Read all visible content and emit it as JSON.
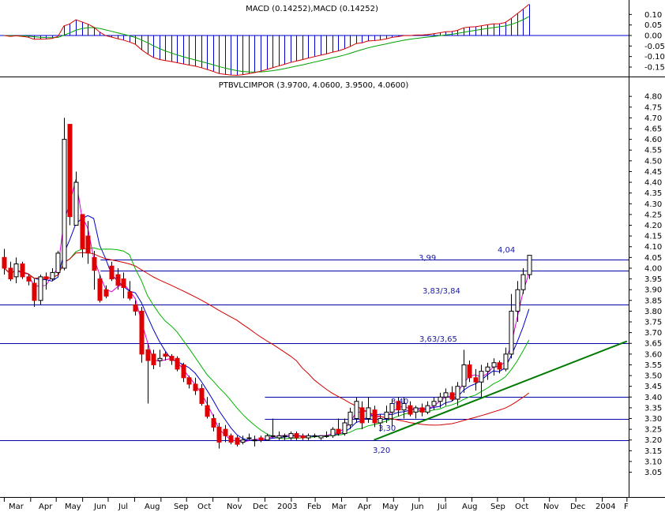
{
  "macd_panel": {
    "title": "MACD (0.14252),MACD (0.14252)",
    "ticks": [
      "0.10",
      "0.05",
      "0.00",
      "-0.05",
      "-0.10",
      "-0.15"
    ],
    "tick_values": [
      0.1,
      0.05,
      0.0,
      -0.05,
      -0.1,
      -0.15
    ],
    "ylim": [
      -0.18,
      0.15
    ]
  },
  "price_panel": {
    "title": "PTBVLCIMPOR (3.9700, 4.0600, 3.9500, 4.0600)",
    "ticks": [
      "4.80",
      "4.75",
      "4.70",
      "4.65",
      "4.60",
      "4.55",
      "4.50",
      "4.45",
      "4.40",
      "4.35",
      "4.30",
      "4.25",
      "4.20",
      "4.15",
      "4.10",
      "4.05",
      "4.00",
      "3.95",
      "3.90",
      "3.85",
      "3.80",
      "3.75",
      "3.70",
      "3.65",
      "3.60",
      "3.55",
      "3.50",
      "3.45",
      "3.40",
      "3.35",
      "3.30",
      "3.25",
      "3.20",
      "3.15",
      "3.10",
      "3.05"
    ],
    "ylim": [
      2.975,
      4.83
    ]
  },
  "x_axis": {
    "labels": [
      "Mar",
      "Apr",
      "May",
      "Jun",
      "Jul",
      "Aug",
      "Sep",
      "Oct",
      "Nov",
      "Dec",
      "2003",
      "Feb",
      "Mar",
      "Apr",
      "May",
      "Jun",
      "Jul",
      "Aug",
      "Sep",
      "Oct",
      "Nov",
      "Dec",
      "2004",
      "F"
    ]
  },
  "annotations": [
    {
      "text": "4,04",
      "level": 4.04
    },
    {
      "text": "3,99",
      "level": 3.99
    },
    {
      "text": "3,83/3,84",
      "level": 3.84
    },
    {
      "text": "3,63/3,65",
      "level": 3.65
    },
    {
      "text": "3,40",
      "level": 3.4
    },
    {
      "text": "3,30",
      "level": 3.3
    },
    {
      "text": "3,20",
      "level": 3.2
    }
  ],
  "colors": {
    "candle_up": "#ffffff",
    "candle_down": "#e00000",
    "ma_long": "#d40000",
    "ma_mid": "#00b400",
    "ma_short": "#0000cc",
    "ma_fast": "#e000e0",
    "trendline": "#007a00",
    "level_line": "#0000aa",
    "macd_hist": "#0000cc"
  },
  "chart_data": {
    "type": "candlestick",
    "title": "PTBVLCIMPOR (3.9700, 4.0600, 3.9500, 4.0600)",
    "last_ohlc": {
      "open": 3.97,
      "high": 4.06,
      "low": 3.95,
      "close": 4.06
    },
    "weeks": [
      "2002-03-01",
      "2002-03-08",
      "2002-03-15",
      "2002-03-22",
      "2002-03-29",
      "2002-04-05",
      "2002-04-12",
      "2002-04-19",
      "2002-04-26",
      "2002-05-03",
      "2002-05-10",
      "2002-05-17",
      "2002-05-24",
      "2002-05-31",
      "2002-06-07",
      "2002-06-14",
      "2002-06-21",
      "2002-06-28",
      "2002-07-05",
      "2002-07-12",
      "2002-07-19",
      "2002-07-26",
      "2002-08-02",
      "2002-08-09",
      "2002-08-16",
      "2002-08-23",
      "2002-08-30",
      "2002-09-06",
      "2002-09-13",
      "2002-09-20",
      "2002-09-27",
      "2002-10-04",
      "2002-10-11",
      "2002-10-18",
      "2002-10-25",
      "2002-11-01",
      "2002-11-08",
      "2002-11-15",
      "2002-11-22",
      "2002-11-29",
      "2002-12-06",
      "2002-12-13",
      "2002-12-20",
      "2002-12-27",
      "2003-01-03",
      "2003-01-10",
      "2003-01-17",
      "2003-01-24",
      "2003-01-31",
      "2003-02-07",
      "2003-02-14",
      "2003-02-21",
      "2003-02-28",
      "2003-03-07",
      "2003-03-14",
      "2003-03-21",
      "2003-03-28",
      "2003-04-04",
      "2003-04-11",
      "2003-04-18",
      "2003-04-25",
      "2003-05-02",
      "2003-05-09",
      "2003-05-16",
      "2003-05-23",
      "2003-05-30",
      "2003-06-06",
      "2003-06-13",
      "2003-06-20",
      "2003-06-27",
      "2003-07-04",
      "2003-07-11",
      "2003-07-18",
      "2003-07-25",
      "2003-08-01",
      "2003-08-08",
      "2003-08-15",
      "2003-08-22",
      "2003-08-29",
      "2003-09-05",
      "2003-09-12",
      "2003-09-19",
      "2003-09-26",
      "2003-10-03",
      "2003-10-10",
      "2003-10-17",
      "2003-10-24",
      "2003-10-31",
      "2003-11-07",
      "2003-11-14"
    ],
    "ohlc": [
      [
        4.05,
        4.09,
        3.97,
        4.0
      ],
      [
        4.0,
        4.03,
        3.94,
        3.95
      ],
      [
        3.96,
        4.05,
        3.93,
        4.02
      ],
      [
        4.02,
        4.03,
        3.95,
        3.96
      ],
      [
        3.96,
        3.97,
        3.92,
        3.94
      ],
      [
        3.93,
        3.95,
        3.82,
        3.85
      ],
      [
        3.85,
        3.97,
        3.83,
        3.96
      ],
      [
        3.96,
        3.98,
        3.9,
        3.95
      ],
      [
        3.95,
        4.0,
        3.94,
        3.98
      ],
      [
        3.98,
        4.08,
        3.97,
        4.07
      ],
      [
        4.0,
        4.7,
        3.99,
        4.6
      ],
      [
        4.67,
        4.67,
        4.2,
        4.24
      ],
      [
        4.2,
        4.45,
        4.2,
        4.4
      ],
      [
        4.25,
        4.25,
        4.05,
        4.09
      ],
      [
        4.15,
        4.22,
        4.02,
        4.07
      ],
      [
        4.05,
        4.08,
        3.9,
        3.99
      ],
      [
        3.95,
        3.97,
        3.84,
        3.85
      ],
      [
        3.9,
        3.92,
        3.86,
        3.87
      ],
      [
        4.01,
        4.03,
        3.94,
        3.95
      ],
      [
        3.97,
        4.0,
        3.9,
        3.92
      ],
      [
        3.95,
        3.98,
        3.86,
        3.91
      ],
      [
        3.89,
        3.94,
        3.85,
        3.86
      ],
      [
        3.83,
        3.85,
        3.78,
        3.8
      ],
      [
        3.8,
        3.82,
        3.56,
        3.6
      ],
      [
        3.62,
        3.65,
        3.37,
        3.57
      ],
      [
        3.6,
        3.62,
        3.53,
        3.55
      ],
      [
        3.57,
        3.62,
        3.54,
        3.58
      ],
      [
        3.6,
        3.61,
        3.57,
        3.59
      ],
      [
        3.59,
        3.6,
        3.55,
        3.57
      ],
      [
        3.58,
        3.59,
        3.52,
        3.53
      ],
      [
        3.55,
        3.56,
        3.47,
        3.49
      ],
      [
        3.49,
        3.5,
        3.44,
        3.46
      ],
      [
        3.46,
        3.49,
        3.41,
        3.43
      ],
      [
        3.44,
        3.46,
        3.36,
        3.37
      ],
      [
        3.36,
        3.4,
        3.3,
        3.31
      ],
      [
        3.3,
        3.32,
        3.24,
        3.26
      ],
      [
        3.26,
        3.28,
        3.16,
        3.19
      ],
      [
        3.25,
        3.27,
        3.19,
        3.22
      ],
      [
        3.22,
        3.23,
        3.18,
        3.19
      ],
      [
        3.21,
        3.22,
        3.17,
        3.18
      ],
      [
        3.19,
        3.22,
        3.18,
        3.2
      ],
      [
        3.21,
        3.23,
        3.2,
        3.21
      ],
      [
        3.2,
        3.22,
        3.17,
        3.2
      ],
      [
        3.21,
        3.22,
        3.19,
        3.2
      ],
      [
        3.2,
        3.23,
        3.2,
        3.22
      ],
      [
        3.22,
        3.3,
        3.21,
        3.22
      ],
      [
        3.21,
        3.24,
        3.2,
        3.22
      ],
      [
        3.22,
        3.23,
        3.2,
        3.22
      ],
      [
        3.21,
        3.24,
        3.2,
        3.23
      ],
      [
        3.23,
        3.24,
        3.2,
        3.21
      ],
      [
        3.22,
        3.23,
        3.2,
        3.21
      ],
      [
        3.21,
        3.23,
        3.2,
        3.22
      ],
      [
        3.22,
        3.23,
        3.21,
        3.22
      ],
      [
        3.21,
        3.22,
        3.2,
        3.22
      ],
      [
        3.22,
        3.24,
        3.21,
        3.22
      ],
      [
        3.22,
        3.26,
        3.21,
        3.25
      ],
      [
        3.25,
        3.3,
        3.22,
        3.23
      ],
      [
        3.23,
        3.3,
        3.22,
        3.28
      ],
      [
        3.27,
        3.35,
        3.25,
        3.33
      ],
      [
        3.3,
        3.4,
        3.28,
        3.38
      ],
      [
        3.35,
        3.38,
        3.25,
        3.28
      ],
      [
        3.3,
        3.4,
        3.28,
        3.35
      ],
      [
        3.34,
        3.36,
        3.26,
        3.28
      ],
      [
        3.28,
        3.32,
        3.24,
        3.3
      ],
      [
        3.3,
        3.36,
        3.28,
        3.33
      ],
      [
        3.33,
        3.39,
        3.26,
        3.37
      ],
      [
        3.38,
        3.4,
        3.31,
        3.34
      ],
      [
        3.34,
        3.4,
        3.3,
        3.37
      ],
      [
        3.36,
        3.38,
        3.31,
        3.32
      ],
      [
        3.33,
        3.36,
        3.3,
        3.35
      ],
      [
        3.35,
        3.37,
        3.31,
        3.33
      ],
      [
        3.33,
        3.38,
        3.32,
        3.36
      ],
      [
        3.36,
        3.4,
        3.34,
        3.38
      ],
      [
        3.38,
        3.42,
        3.35,
        3.4
      ],
      [
        3.4,
        3.44,
        3.36,
        3.42
      ],
      [
        3.42,
        3.45,
        3.38,
        3.39
      ],
      [
        3.39,
        3.47,
        3.36,
        3.45
      ],
      [
        3.45,
        3.62,
        3.42,
        3.55
      ],
      [
        3.55,
        3.57,
        3.47,
        3.49
      ],
      [
        3.49,
        3.53,
        3.43,
        3.47
      ],
      [
        3.47,
        3.55,
        3.4,
        3.52
      ],
      [
        3.52,
        3.56,
        3.48,
        3.54
      ],
      [
        3.54,
        3.58,
        3.5,
        3.56
      ],
      [
        3.56,
        3.57,
        3.51,
        3.53
      ],
      [
        3.53,
        3.63,
        3.52,
        3.6
      ],
      [
        3.6,
        3.88,
        3.58,
        3.8
      ],
      [
        3.8,
        3.94,
        3.75,
        3.9
      ],
      [
        3.9,
        4.0,
        3.88,
        3.97
      ],
      [
        3.97,
        4.06,
        3.95,
        4.06
      ]
    ],
    "levels": [
      4.04,
      3.99,
      3.83,
      3.65,
      3.4,
      3.3,
      3.2
    ],
    "trendline": {
      "from": [
        "2003-05-09",
        3.2
      ],
      "to": [
        "2004-03-01",
        3.66
      ]
    },
    "moving_average_periods": [
      3,
      6,
      12,
      40
    ],
    "macd_ylim": [
      -0.18,
      0.15
    ],
    "xlim": [
      "2002-02-24",
      "2004-03-03"
    ]
  }
}
